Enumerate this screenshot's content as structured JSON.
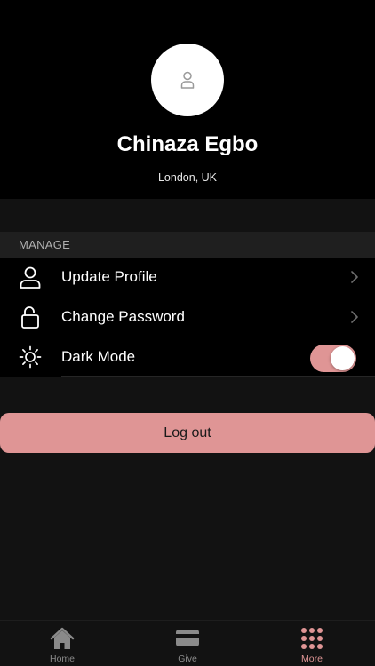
{
  "profile": {
    "name": "Chinaza Egbo",
    "location": "London, UK",
    "avatar_icon": "user-placeholder-icon"
  },
  "manage_section": {
    "title": "MANAGE",
    "items": [
      {
        "label": "Update Profile",
        "icon": "user-icon",
        "control": "chevron"
      },
      {
        "label": "Change Password",
        "icon": "unlock-icon",
        "control": "chevron"
      },
      {
        "label": "Dark Mode",
        "icon": "sun-icon",
        "control": "toggle",
        "enabled": true
      }
    ]
  },
  "logout": {
    "label": "Log out"
  },
  "tab_bar": {
    "tabs": [
      {
        "label": "Home",
        "icon": "home-icon",
        "active": false
      },
      {
        "label": "Give",
        "icon": "card-icon",
        "active": false
      },
      {
        "label": "More",
        "icon": "grid-dots-icon",
        "active": true
      }
    ]
  },
  "colors": {
    "accent": "#df9595",
    "background": "#121212",
    "header_background": "#000000",
    "inactive_tab": "#8a8a8a"
  }
}
